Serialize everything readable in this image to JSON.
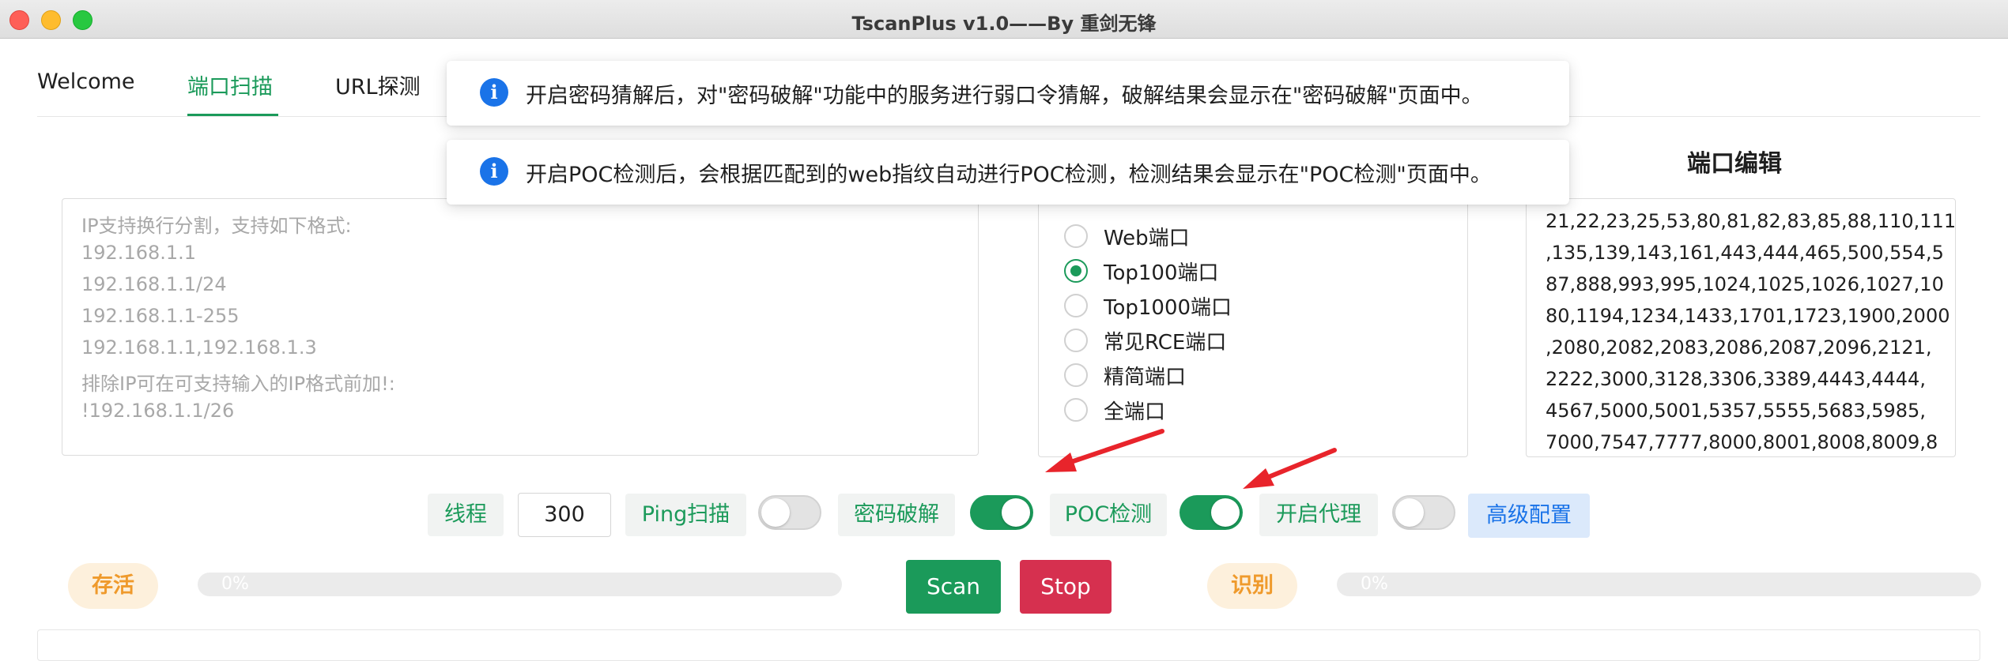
{
  "window": {
    "title": "TscanPlus v1.0——By 重剑无锋"
  },
  "tabs": [
    {
      "label": "Welcome"
    },
    {
      "label": "端口扫描"
    },
    {
      "label": "URL探测"
    }
  ],
  "notifications": [
    {
      "icon": "info-icon",
      "text": "开启密码猜解后，对\"密码破解\"功能中的服务进行弱口令猜解，破解结果会显示在\"密码破解\"页面中。"
    },
    {
      "icon": "info-icon",
      "text": "开启POC检测后，会根据匹配到的web指纹自动进行POC检测，检测结果会显示在\"POC检测\"页面中。"
    }
  ],
  "target_input": {
    "placeholder_lines": [
      "IP支持换行分割，支持如下格式:",
      "192.168.1.1",
      "192.168.1.1/24",
      "192.168.1.1-255",
      "192.168.1.1,192.168.1.3",
      "排除IP可在可支持输入的IP格式前加!:",
      "!192.168.1.1/26"
    ]
  },
  "port_types": {
    "options": [
      "Web端口",
      "Top100端口",
      "Top1000端口",
      "常见RCE端口",
      "精简端口",
      "全端口"
    ],
    "selected": "Top100端口"
  },
  "port_edit": {
    "title": "端口编辑",
    "lines": [
      "21,22,23,25,53,80,81,82,83,85,88,110,111",
      ",135,139,143,161,443,444,465,500,554,5",
      "87,888,993,995,1024,1025,1026,1027,10",
      "80,1194,1234,1433,1701,1723,1900,2000",
      ",2080,2082,2083,2086,2087,2096,2121,",
      "2222,3000,3128,3306,3389,4443,4444,",
      "4567,5000,5001,5357,5555,5683,5985,",
      "7000,7547,7777,8000,8001,8008,8009,8"
    ]
  },
  "controls": {
    "threads_label": "线程",
    "threads_value": "300",
    "ping_label": "Ping扫描",
    "ping_on": false,
    "crack_label": "密码破解",
    "crack_on": true,
    "poc_label": "POC检测",
    "poc_on": true,
    "proxy_label": "开启代理",
    "proxy_on": false,
    "advanced_label": "高级配置"
  },
  "progress": {
    "alive_label": "存活",
    "alive_percent": "0%",
    "scan_label": "Scan",
    "stop_label": "Stop",
    "identify_label": "识别",
    "identify_percent": "0%"
  },
  "colors": {
    "accent_green": "#1b9a5a",
    "stop_red": "#d6304f",
    "info_blue": "#1a73e8",
    "arrow_red": "#e8242b",
    "pill_orange": "#ef9a2c"
  }
}
